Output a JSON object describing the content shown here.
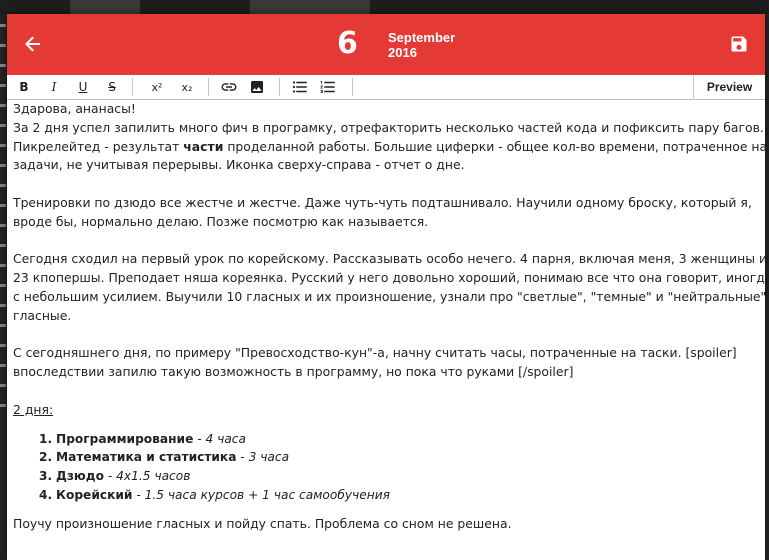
{
  "header": {
    "day": "6",
    "month": "September",
    "year": "2016",
    "color": "#e53935"
  },
  "toolbar": {
    "bold_label": "B",
    "italic_label": "I",
    "underline_label": "U",
    "strike_label": "S",
    "superscript_label": "x²",
    "subscript_label": "x₂",
    "preview_label": "Preview"
  },
  "content": {
    "greeting": "Здарова, ананасы!",
    "p1_l1": "За 2 дня успел запилить много фич в програмку, отрефакторить несколько частей кода и пофиксить пару багов.",
    "p1_l2_a": "Пикрелейтед - результат ",
    "p1_l2_b": "части",
    "p1_l2_c": " проделанной работы. Большие циферки - общее кол-во времени, потраченное на",
    "p1_l3": "задачи, не учитывая перерывы. Иконка сверху-справа - отчет о дне.",
    "p2_l1": "Тренировки по дзюдо все жестче и жестче. Даже чуть-чуть подташнивало. Научили одному броску, который я,",
    "p2_l2": "вроде бы, нормально делаю. Позже посмотрю как называется.",
    "p3_l1": "Сегодня сходил на первый урок по корейскому. Рассказывать особо нечего. 4 парня, включая меня, 3 женщины и",
    "p3_l2": "23 кпопершы. Преподает няша кореянка. Русский у него довольно хороший, понимаю все что она говорит, иногда",
    "p3_l3": "с небольшим усилием. Выучили 10 гласных и их произношение, узнали про \"светлые\", \"темные\" и \"нейтральные\"",
    "p3_l4": "гласные.",
    "p4_l1": "С сегодняшнего дня, по примеру \"Превосходство-кун\"-а, начну считать часы, потраченные на таски. [spoiler]",
    "p4_l2": "впоследствии запилю такую возможность в программу, но пока что руками [/spoiler]",
    "days_heading": "2 дня:",
    "list": [
      {
        "num": "1.",
        "title": "Программирование",
        "detail": " - 4 часа"
      },
      {
        "num": "2.",
        "title": "Математика и статистика",
        "detail": " - 3 часа"
      },
      {
        "num": "3.",
        "title": "Дзюдо",
        "detail": " - 4x1.5 часов"
      },
      {
        "num": "4.",
        "title": "Корейский",
        "detail": " - 1.5 часа курсов + 1 час самообучения"
      }
    ],
    "closing": "Поучу произношение гласных и пойду спать. Проблема со сном не решена."
  }
}
